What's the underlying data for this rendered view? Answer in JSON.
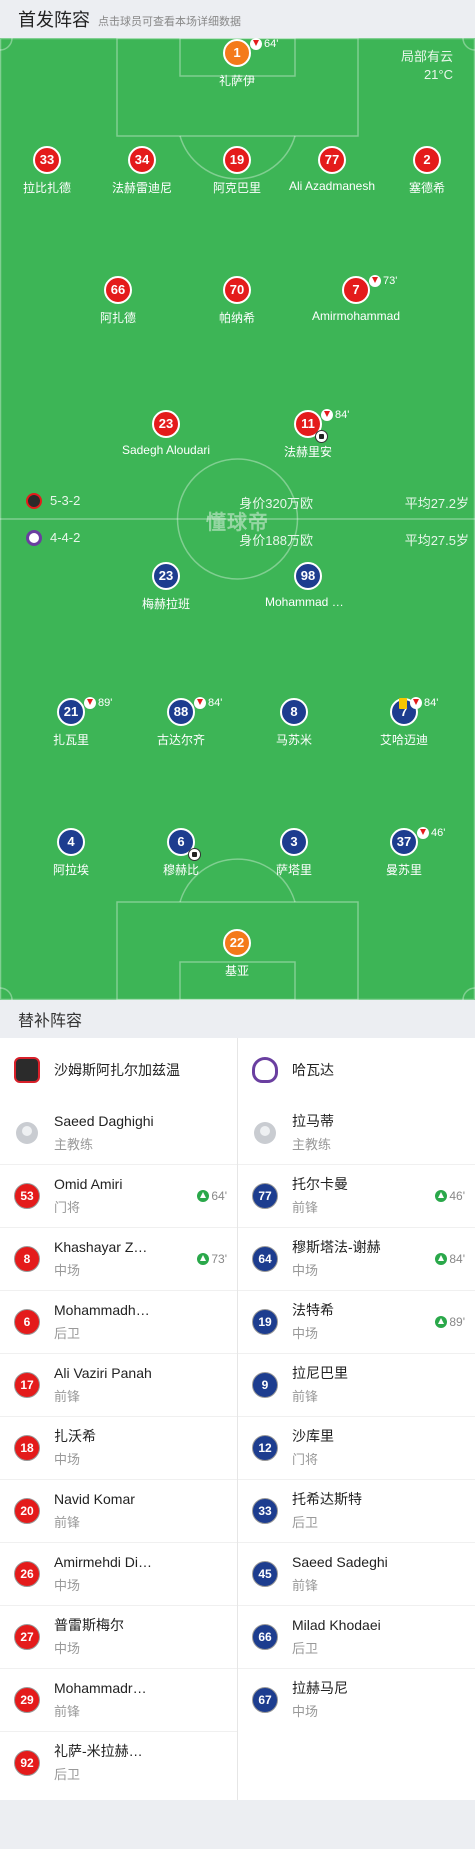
{
  "header": {
    "title": "首发阵容",
    "hint": "点击球员可查看本场详细数据"
  },
  "weather": {
    "condition": "局部有云",
    "temp": "21°C"
  },
  "watermark": "懂球帝",
  "home": {
    "formation": "5-3-2",
    "value": "身价320万欧",
    "age": "平均27.2岁",
    "color": "#e41b1b"
  },
  "away": {
    "formation": "4-4-2",
    "value": "身价188万欧",
    "age": "平均27.5岁",
    "color": "#1d3d8f"
  },
  "home_players": [
    {
      "num": "1",
      "name": "礼萨伊",
      "gk": true,
      "sub": "64'"
    },
    {
      "num": "33",
      "name": "拉比扎德"
    },
    {
      "num": "34",
      "name": "法赫雷迪尼"
    },
    {
      "num": "19",
      "name": "阿克巴里"
    },
    {
      "num": "77",
      "name": "Ali Azadmanesh"
    },
    {
      "num": "2",
      "name": "塞德希"
    },
    {
      "num": "66",
      "name": "阿扎德"
    },
    {
      "num": "70",
      "name": "帕纳希"
    },
    {
      "num": "7",
      "name": "Amirmohammad",
      "sub": "73'"
    },
    {
      "num": "23",
      "name": "Sadegh Aloudari"
    },
    {
      "num": "11",
      "name": "法赫里安",
      "sub": "84'",
      "goal": true
    }
  ],
  "away_players": [
    {
      "num": "23",
      "name": "梅赫拉班"
    },
    {
      "num": "98",
      "name": "Mohammad Hossein"
    },
    {
      "num": "21",
      "name": "扎瓦里",
      "sub": "89'"
    },
    {
      "num": "88",
      "name": "古达尔齐",
      "sub": "84'"
    },
    {
      "num": "8",
      "name": "马苏米"
    },
    {
      "num": "7",
      "name": "艾哈迈迪",
      "sub": "84'",
      "yellow": true
    },
    {
      "num": "4",
      "name": "阿拉埃"
    },
    {
      "num": "6",
      "name": "穆赫比",
      "goal": true
    },
    {
      "num": "3",
      "name": "萨塔里"
    },
    {
      "num": "37",
      "name": "曼苏里",
      "sub": "46'"
    },
    {
      "num": "22",
      "name": "基亚",
      "gk": true
    }
  ],
  "subs_header": "替补阵容",
  "bench_home": {
    "team": "沙姆斯阿扎尔加兹温",
    "coach": {
      "name": "Saeed Daghighi",
      "role": "主教练"
    },
    "players": [
      {
        "num": "53",
        "name": "Omid Amiri",
        "pos": "门将",
        "in": "64'"
      },
      {
        "num": "8",
        "name": "Khashayar Zarei",
        "pos": "中场",
        "in": "73'"
      },
      {
        "num": "6",
        "name": "Mohammadhossein",
        "pos": "后卫"
      },
      {
        "num": "17",
        "name": "Ali Vaziri Panah",
        "pos": "前锋"
      },
      {
        "num": "18",
        "name": "扎沃希",
        "pos": "中场"
      },
      {
        "num": "20",
        "name": "Navid Komar",
        "pos": "前锋"
      },
      {
        "num": "26",
        "name": "Amirmehdi Dibaj",
        "pos": "中场"
      },
      {
        "num": "27",
        "name": "普雷斯梅尔",
        "pos": "中场"
      },
      {
        "num": "29",
        "name": "Mohammadreza",
        "pos": "前锋"
      },
      {
        "num": "92",
        "name": "礼萨-米拉赫马迪",
        "pos": "后卫"
      }
    ]
  },
  "bench_away": {
    "team": "哈瓦达",
    "coach": {
      "name": "拉马蒂",
      "role": "主教练"
    },
    "players": [
      {
        "num": "77",
        "name": "托尔卡曼",
        "pos": "前锋",
        "in": "46'"
      },
      {
        "num": "64",
        "name": "穆斯塔法-谢赫",
        "pos": "中场",
        "in": "84'"
      },
      {
        "num": "19",
        "name": "法特希",
        "pos": "中场",
        "in": "89'"
      },
      {
        "num": "9",
        "name": "拉尼巴里",
        "pos": "前锋"
      },
      {
        "num": "12",
        "name": "沙库里",
        "pos": "门将"
      },
      {
        "num": "33",
        "name": "托希达斯特",
        "pos": "后卫"
      },
      {
        "num": "45",
        "name": "Saeed Sadeghi",
        "pos": "前锋"
      },
      {
        "num": "66",
        "name": "Milad Khodaei",
        "pos": "后卫"
      },
      {
        "num": "67",
        "name": "拉赫马尼",
        "pos": "中场"
      }
    ]
  }
}
